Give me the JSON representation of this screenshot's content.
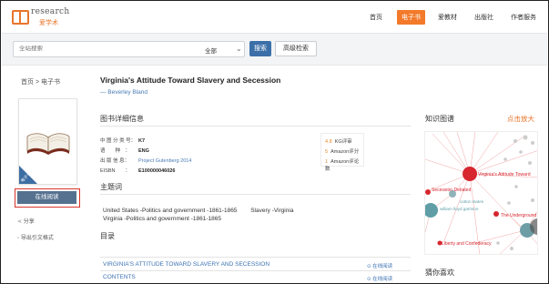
{
  "header": {
    "logo_en": "research",
    "logo_cn": "爱学术",
    "nav": [
      "首页",
      "电子书",
      "爱教材",
      "出版社",
      "作者服务"
    ],
    "active_nav": "电子书",
    "colors": {
      "accent": "#f37a2b",
      "primary": "#3c6fa8"
    }
  },
  "search": {
    "placeholder": "全站搜索",
    "select_value": "全部",
    "search_label": "搜索",
    "advanced_label": "高级检索"
  },
  "breadcrumb": "首页 > 电子书",
  "cover": {
    "badge": "电子书"
  },
  "actions": {
    "read_online": "在线阅读",
    "share": "分享",
    "export_citation": "导出引文格式"
  },
  "book": {
    "title": "Virginia's Attitude Toward Slavery and Secession",
    "author": "— Beverley Bland"
  },
  "details": {
    "heading": "图书详细信息",
    "rows": [
      {
        "label": "中 图 分 类 号：",
        "value": "K7"
      },
      {
        "label": "语　　种　：",
        "value": "ENG"
      },
      {
        "label": "出 版 信 息：",
        "value": "Project Gutenberg 2014"
      },
      {
        "label": "EISBN　　：",
        "value": "E100000046026"
      }
    ],
    "stats": [
      {
        "num": "4.8",
        "label": "KG评审"
      },
      {
        "num": "5",
        "label": "Amazon评分"
      },
      {
        "num": "1",
        "label": "Amazon评论数"
      }
    ]
  },
  "subjects": {
    "heading": "主题词",
    "line1": "United States -Politics and government -1861-1865　　 Slavery -Virginia",
    "line2": "Virginia -Politics and government -1861-1865"
  },
  "toc": {
    "heading": "目录",
    "items": [
      {
        "label": "VIRGINIA'S ATTITUDE TOWARD SLAVERY AND SECESSION",
        "action": "在线阅读"
      },
      {
        "label": "CONTENTS",
        "action": "在线阅读"
      }
    ]
  },
  "knowledge_graph": {
    "heading": "知识图谱",
    "zoom_label": "点击放大",
    "nodes": [
      "Virginia's Attitude Toward",
      "Secession Debated",
      "cotton states",
      "william lloyd garrison",
      "The Underground",
      "Liberty and Confederacy"
    ]
  },
  "recommend": {
    "heading": "猜你喜欢"
  }
}
